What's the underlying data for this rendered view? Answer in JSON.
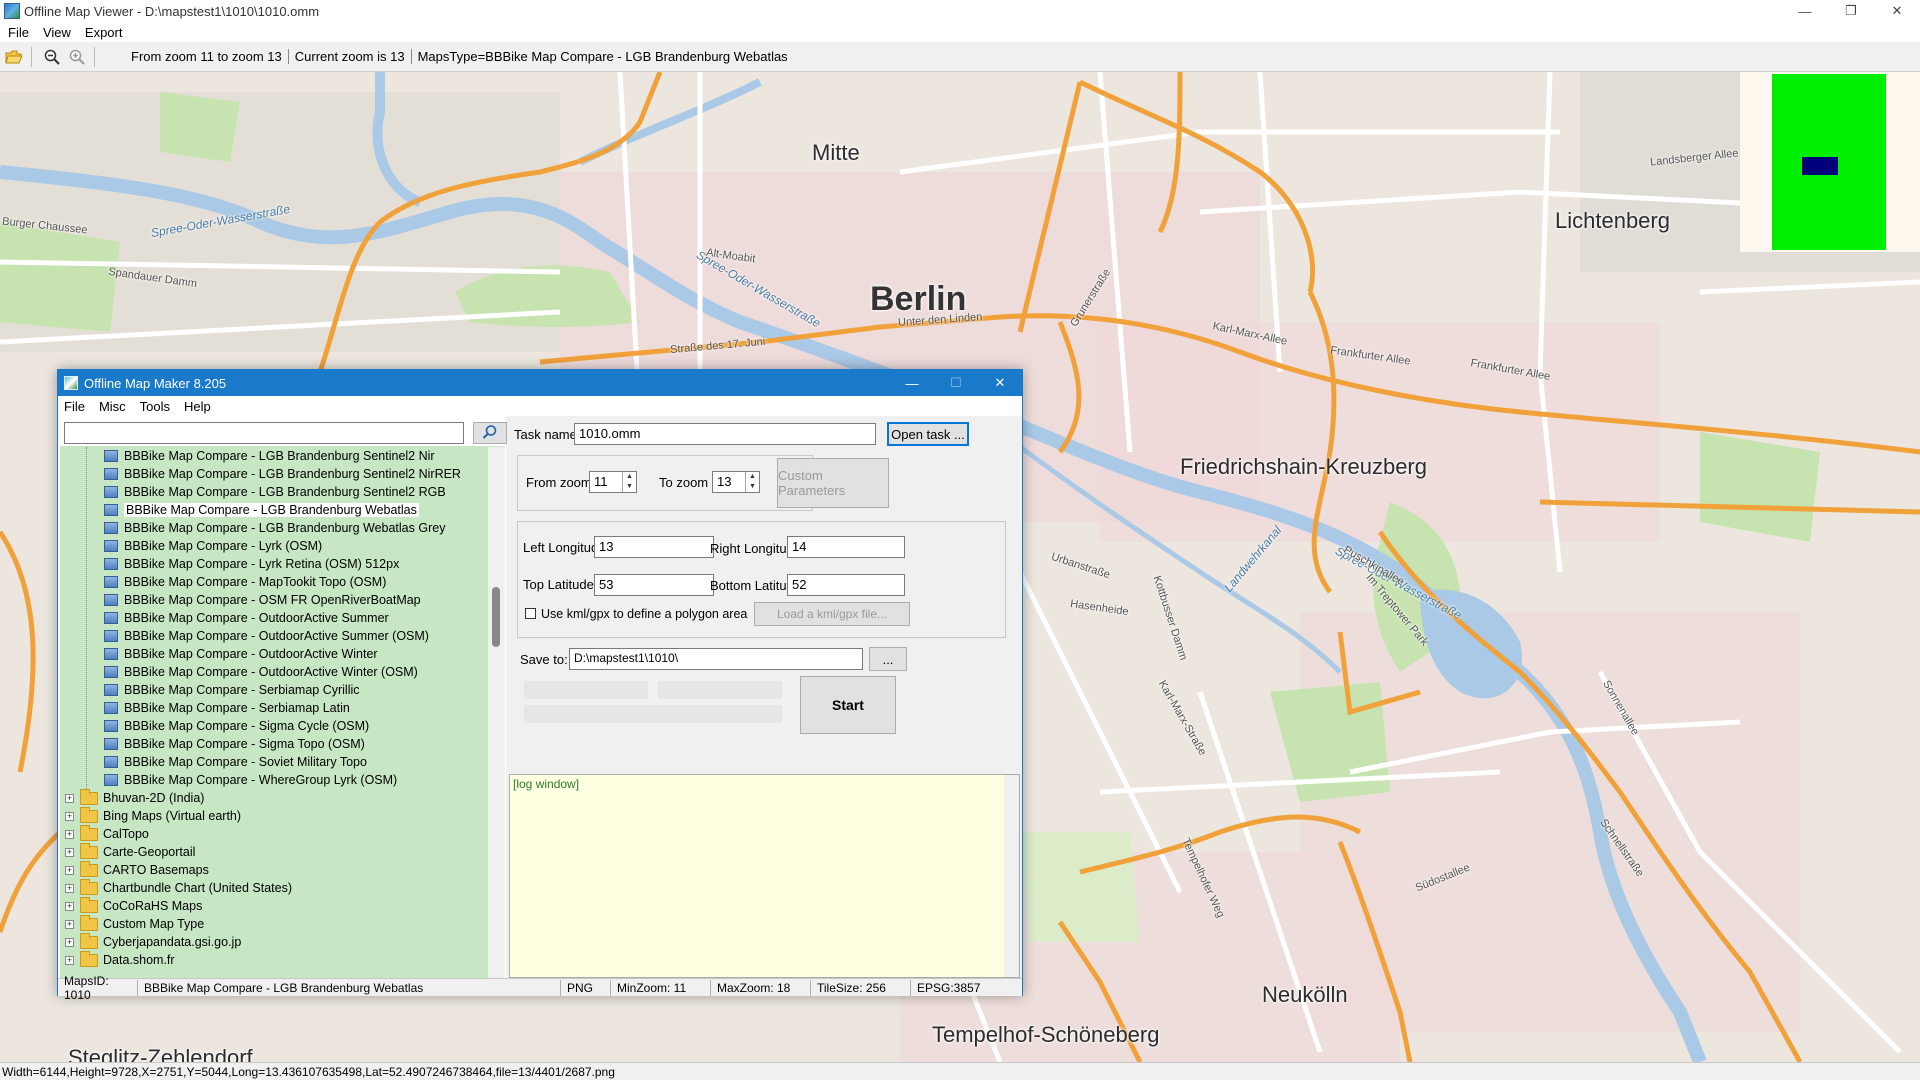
{
  "viewer": {
    "title": "Offline Map Viewer - D:\\mapstest1\\1010\\1010.omm",
    "menu": [
      "File",
      "View",
      "Export"
    ],
    "toolbar": {
      "zoom_range": "From zoom 11 to zoom 13",
      "current_zoom": "Current zoom is 13",
      "maps_type": "MapsType=BBBike Map Compare - LGB Brandenburg Webatlas"
    },
    "status": "Width=6144,Height=9728,X=2751,Y=5044,Long=13.436107635498,Lat=52.4907246738464,file=13/4401/2687.png",
    "window_controls": [
      "—",
      "❐",
      "✕"
    ]
  },
  "map": {
    "labels": {
      "berlin": "Berlin",
      "mitte": "Mitte",
      "lichtenberg": "Lichtenberg",
      "friedrichshain": "Friedrichshain-Kreuzberg",
      "neukoelln": "Neukölln",
      "tempelhof": "Tempelhof-Schöneberg",
      "steglitz": "Steglitz-Zehlendorf",
      "spree_oder_west": "Spree-Oder-Wasserstraße",
      "spree_oder_mid": "Spree-Oder-Wasserstraße",
      "spree_oder_east": "Spree-Oder-Wasserstraße",
      "karl_marx": "Karl-Marx-Allee",
      "frankfurter": "Frankfurter Allee",
      "frankfurter2": "Frankfurter Allee",
      "unter_den_linden": "Unter den Linden",
      "strasse_17_juni": "Straße des 17. Juni",
      "alt_moabit": "Alt-Moabit",
      "spandauer_damm": "Spandauer Damm",
      "landsberger": "Landsberger Allee",
      "sonnenallee": "Sonnenallee",
      "karl_marx_strasse": "Karl-Marx-Straße",
      "hasenheide": "Hasenheide",
      "urbanstrasse": "Urbanstraße",
      "puschkinallee": "Puschkinallee",
      "treptower_park": "Im Treptower Park",
      "tempelhofer_weg": "Tempelhofer Weg",
      "suedostallee": "Südostallee",
      "schlesische": "Schnellstraße",
      "burger_chaussee": "Burger Chaussee",
      "grunerstrasse": "Grunerstraße",
      "kottbusser": "Kottbusser Damm",
      "landwehrkanal": "Landwehrkanal"
    }
  },
  "maker": {
    "title": "Offline Map Maker 8.205",
    "menu": [
      "File",
      "Misc",
      "Tools",
      "Help"
    ],
    "search": {
      "value": "",
      "placeholder": ""
    },
    "tree": {
      "leaves": [
        "BBBike Map Compare - LGB Brandenburg Sentinel2 Nir",
        "BBBike Map Compare - LGB Brandenburg Sentinel2 NirRER",
        "BBBike Map Compare - LGB Brandenburg Sentinel2 RGB",
        "BBBike Map Compare - LGB Brandenburg Webatlas",
        "BBBike Map Compare - LGB Brandenburg Webatlas Grey",
        "BBBike Map Compare - Lyrk (OSM)",
        "BBBike Map Compare - Lyrk Retina (OSM) 512px",
        "BBBike Map Compare - MapTookit Topo (OSM)",
        "BBBike Map Compare - OSM FR OpenRiverBoatMap",
        "BBBike Map Compare - OutdoorActive Summer",
        "BBBike Map Compare - OutdoorActive Summer (OSM)",
        "BBBike Map Compare - OutdoorActive Winter",
        "BBBike Map Compare - OutdoorActive Winter (OSM)",
        "BBBike Map Compare - Serbiamap Cyrillic",
        "BBBike Map Compare - Serbiamap Latin",
        "BBBike Map Compare - Sigma Cycle (OSM)",
        "BBBike Map Compare - Sigma Topo (OSM)",
        "BBBike Map Compare - Soviet Military Topo",
        "BBBike Map Compare - WhereGroup Lyrk (OSM)"
      ],
      "folders": [
        "Bhuvan-2D (India)",
        "Bing Maps (Virtual earth)",
        "CalTopo",
        "Carte-Geoportail",
        "CARTO Basemaps",
        "Chartbundle Chart (United States)",
        "CoCoRaHS Maps",
        "Custom Map Type",
        "Cyberjapandata.gsi.go.jp",
        "Data.shom.fr"
      ]
    },
    "task": {
      "task_name_label": "Task name",
      "task_name_value": "1010.omm",
      "open_task_label": "Open task ...",
      "from_zoom_label": "From zoom",
      "from_zoom_value": "11",
      "to_zoom_label": "To zoom",
      "to_zoom_value": "13",
      "custom_params_label": "Custom Parameters",
      "left_lon_label": "Left Longitude",
      "left_lon_value": "13",
      "right_lon_label": "Right Longitude",
      "right_lon_value": "14",
      "top_lat_label": "Top Latitude",
      "top_lat_value": "53",
      "bottom_lat_label": "Bottom Latitude",
      "bottom_lat_value": "52",
      "kml_checkbox_label": "Use kml/gpx to define a polygon area",
      "load_kml_label": "Load a kml/gpx file...",
      "save_to_label": "Save to:",
      "save_to_value": "D:\\mapstest1\\1010\\",
      "browse_label": "...",
      "start_label": "Start",
      "log_text": "[log window]"
    },
    "status": {
      "maps_id": "MapsID: 1010",
      "map_name": "BBBike Map Compare - LGB Brandenburg Webatlas",
      "format": "PNG",
      "min_zoom": "MinZoom: 11",
      "max_zoom": "MaxZoom: 18",
      "tile_size": "TileSize: 256",
      "epsg": "EPSG:3857"
    },
    "window_controls": [
      "—",
      "☐",
      "✕"
    ]
  },
  "colors": {
    "road_major": "#f0a13a",
    "road_minor": "#ffffff",
    "water": "#a9c9e6",
    "park": "#c7e3b0",
    "map_bg": "#ece6df",
    "title_blue": "#1979ca",
    "tree_green": "#c7e6c4",
    "minimap_green": "#00ee00",
    "minimap_blue": "#00007a"
  },
  "icons": {
    "open_folder": "open-folder-icon",
    "zoom_out": "zoom-out-icon",
    "zoom_in": "zoom-in-icon",
    "search": "search-icon"
  }
}
